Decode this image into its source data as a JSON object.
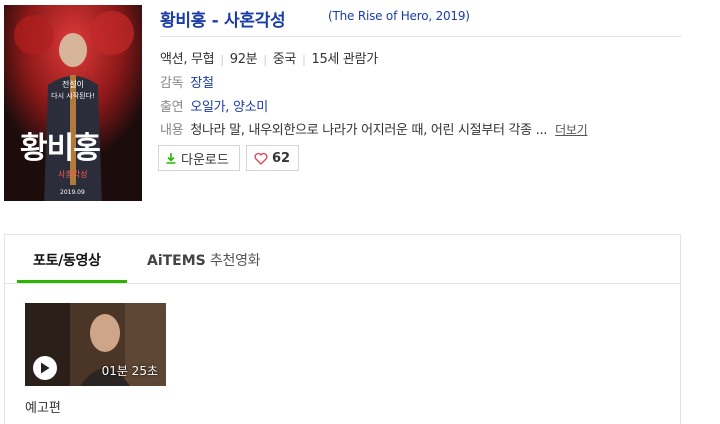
{
  "movie": {
    "title": "황비홍 - 사혼각성",
    "subtitle": "(The Rise of Hero, 2019)",
    "genre": "액션, 무협",
    "runtime": "92분",
    "country": "중국",
    "rating": "15세 관람가",
    "director_label": "감독",
    "director": "장철",
    "cast_label": "출연",
    "cast": "오일가, 양소미",
    "synopsis_label": "내용",
    "synopsis": "청나라 말, 내우외한으로 나라가 어지러운 때, 어린 시절부터 각종 ...",
    "more": "더보기"
  },
  "poster": {
    "tagline_1": "전설이",
    "tagline_2": "다시 시작된다!",
    "title_art": "황비홍",
    "subtitle_art": "사혼각성",
    "date": "2019.09"
  },
  "actions": {
    "download_label": "다운로드",
    "like_count": "62"
  },
  "tabs": {
    "photo": "포토/동영상",
    "aitems_brand": "AiTEMS",
    "aitems_rest": " 추천영화"
  },
  "media": {
    "duration": "01분 25초",
    "label": "예고편"
  },
  "colors": {
    "link": "#1a3ca8",
    "accent": "#2db400",
    "like": "#e0404f"
  }
}
